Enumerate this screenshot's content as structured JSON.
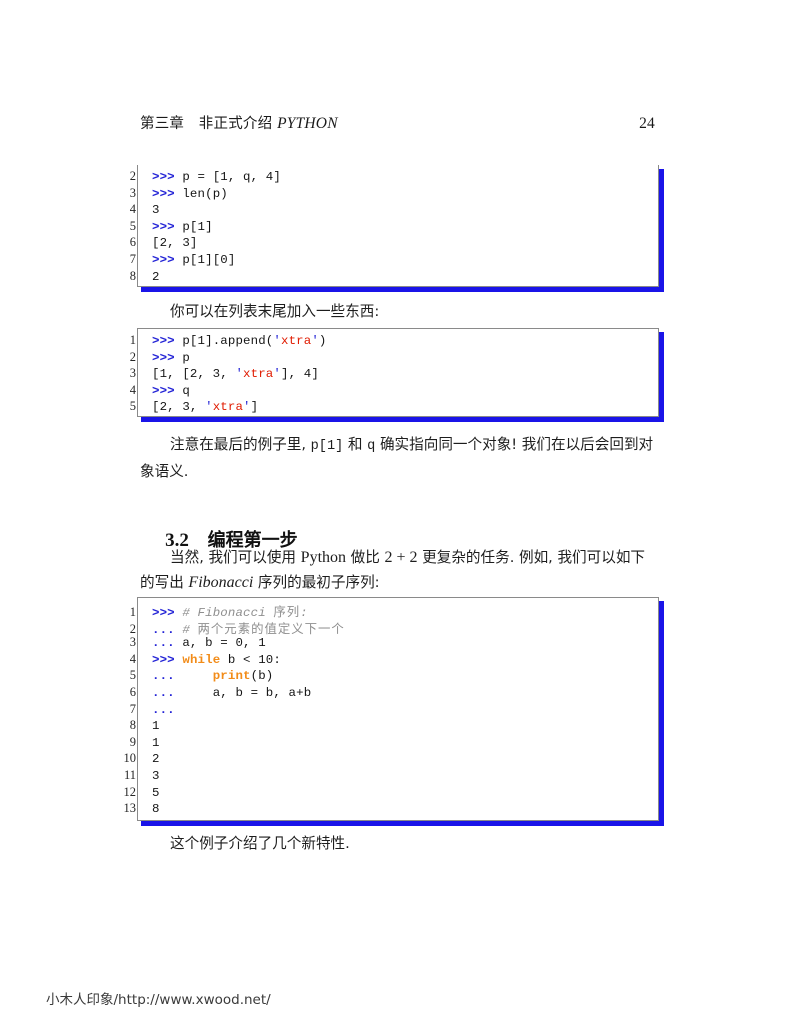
{
  "header": {
    "chapter_cjk": "第三章　非正式介绍 ",
    "chapter_latin": "PYTHON",
    "page_number": "24"
  },
  "colors": {
    "shadow_blue": "#1a14e8",
    "prompt_blue": "#2323d6",
    "string_red": "#e01b00",
    "keyword_orange": "#f28c19",
    "comment_gray": "#8f8f8f",
    "frame_gray": "#8a8a8a"
  },
  "listing1": {
    "lines": [
      {
        "no": "2",
        "code": ">>> p = [1, q, 4]"
      },
      {
        "no": "3",
        "code": ">>> len(p)"
      },
      {
        "no": "4",
        "code": "3"
      },
      {
        "no": "5",
        "code": ">>> p[1]"
      },
      {
        "no": "6",
        "code": "[2, 3]"
      },
      {
        "no": "7",
        "code": ">>> p[1][0]"
      },
      {
        "no": "8",
        "code": "2"
      }
    ]
  },
  "para1": {
    "text": "你可以在列表末尾加入一些东西:"
  },
  "listing2": {
    "lines": [
      {
        "no": "1",
        "code": ">>> p[1].append('xtra')"
      },
      {
        "no": "2",
        "code": ">>> p"
      },
      {
        "no": "3",
        "code": "[1, [2, 3, 'xtra'], 4]"
      },
      {
        "no": "4",
        "code": ">>> q"
      },
      {
        "no": "5",
        "code": "[2, 3, 'xtra']"
      }
    ]
  },
  "para2": {
    "part1": "注意在最后的例子里, ",
    "mono1": "p[1]",
    "part2": " 和 ",
    "mono2": "q",
    "part3": " 确实指向同一个对象! 我们在以后会回到对象语义."
  },
  "section": {
    "number": "3.2",
    "title": "编程第一步"
  },
  "para3": {
    "part1": "当然, 我们可以使用 ",
    "latin1": "Python",
    "part2": " 做比 ",
    "latin2": "2 + 2",
    "part3": " 更复杂的任务. 例如, 我们可以如下的写出 ",
    "italic1": "Fibonacci",
    "part4": " 序列的最初子序列:"
  },
  "listing3": {
    "lines": [
      {
        "no": "1",
        "code": ">>> # Fibonacci 序列:"
      },
      {
        "no": "2",
        "code": "... # 两个元素的值定义下一个"
      },
      {
        "no": "3",
        "code": "... a, b = 0, 1"
      },
      {
        "no": "4",
        "code": ">>> while b < 10:"
      },
      {
        "no": "5",
        "code": "...     print(b)"
      },
      {
        "no": "6",
        "code": "...     a, b = b, a+b"
      },
      {
        "no": "7",
        "code": "..."
      },
      {
        "no": "8",
        "code": "1"
      },
      {
        "no": "9",
        "code": "1"
      },
      {
        "no": "10",
        "code": "2"
      },
      {
        "no": "11",
        "code": "3"
      },
      {
        "no": "12",
        "code": "5"
      },
      {
        "no": "13",
        "code": "8"
      }
    ]
  },
  "para4": {
    "text": "这个例子介绍了几个新特性."
  },
  "watermark": {
    "text": "小木人印象/http://www.xwood.net/"
  }
}
